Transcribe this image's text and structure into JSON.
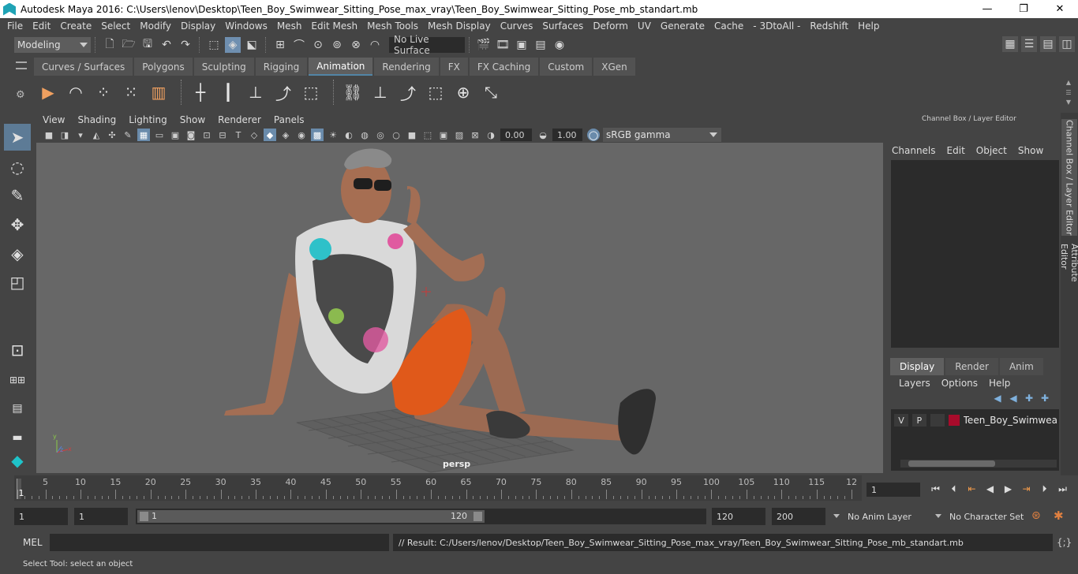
{
  "window": {
    "title": "Autodesk Maya 2016: C:\\Users\\lenov\\Desktop\\Teen_Boy_Swimwear_Sitting_Pose_max_vray\\Teen_Boy_Swimwear_Sitting_Pose_mb_standart.mb",
    "minimize": "—",
    "restore": "❐",
    "close": "✕"
  },
  "menubar": [
    "File",
    "Edit",
    "Create",
    "Select",
    "Modify",
    "Display",
    "Windows",
    "Mesh",
    "Edit Mesh",
    "Mesh Tools",
    "Mesh Display",
    "Curves",
    "Surfaces",
    "Deform",
    "UV",
    "Generate",
    "Cache",
    "- 3DtoAll -",
    "Redshift",
    "Help"
  ],
  "statusline": {
    "mode": "Modeling",
    "live_surface": "No Live Surface"
  },
  "shelf": {
    "tabs": [
      "Curves / Surfaces",
      "Polygons",
      "Sculpting",
      "Rigging",
      "Animation",
      "Rendering",
      "FX",
      "FX Caching",
      "Custom",
      "XGen"
    ],
    "active_tab": "Animation"
  },
  "viewport": {
    "menu": [
      "View",
      "Shading",
      "Lighting",
      "Show",
      "Renderer",
      "Panels"
    ],
    "exposure": "0.00",
    "gamma_value": "1.00",
    "color_space": "sRGB gamma",
    "camera": "persp",
    "axis": {
      "y": "y",
      "x": "x",
      "z": "z"
    }
  },
  "right_panel": {
    "title": "Channel Box / Layer Editor",
    "channel_menu": [
      "Channels",
      "Edit",
      "Object",
      "Show"
    ],
    "tabs": [
      "Display",
      "Render",
      "Anim"
    ],
    "active_tab": "Display",
    "layer_menu": [
      "Layers",
      "Options",
      "Help"
    ],
    "layer": {
      "v": "V",
      "p": "P",
      "name": "Teen_Boy_Swimwear_S",
      "color": "#a80b2b"
    },
    "side_tabs": [
      "Channel Box / Layer Editor",
      "Attribute Editor"
    ]
  },
  "timeline": {
    "ticks": [
      "1",
      "5",
      "10",
      "15",
      "20",
      "25",
      "30",
      "35",
      "40",
      "45",
      "50",
      "55",
      "60",
      "65",
      "70",
      "75",
      "80",
      "85",
      "90",
      "95",
      "100",
      "105",
      "110",
      "115",
      "12"
    ],
    "current_frame": "1"
  },
  "range": {
    "start": "1",
    "playback_start": "1",
    "thumb_start": "1",
    "thumb_end": "120",
    "playback_end": "120",
    "end": "200",
    "anim_layer": "No Anim Layer",
    "character_set": "No Character Set"
  },
  "command": {
    "lang": "MEL",
    "result": "// Result: C:/Users/lenov/Desktop/Teen_Boy_Swimwear_Sitting_Pose_max_vray/Teen_Boy_Swimwear_Sitting_Pose_mb_standart.mb"
  },
  "helpline": "Select Tool: select an object",
  "colors": {
    "accent": "#5285a6",
    "viewport_bg": "#676767",
    "panel_bg": "#444444"
  }
}
